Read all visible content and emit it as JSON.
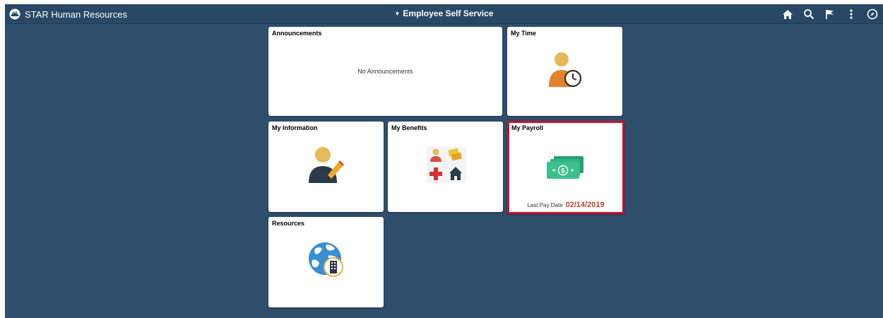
{
  "header": {
    "app_title": "STAR Human Resources",
    "center_title": "Employee Self Service",
    "icons": [
      "home-icon",
      "search-icon",
      "flag-icon",
      "more-vertical-icon",
      "navbar-compass-icon"
    ]
  },
  "tiles": {
    "announcements": {
      "title": "Announcements",
      "body": "No Announcements"
    },
    "my_time": {
      "title": "My Time",
      "icon": "person-clock-icon"
    },
    "my_information": {
      "title": "My Information",
      "icon": "person-pencil-icon"
    },
    "my_benefits": {
      "title": "My Benefits",
      "icon": "benefits-grid-icon"
    },
    "my_payroll": {
      "title": "My Payroll",
      "icon": "money-bills-icon",
      "last_pay_label": "Last Pay Date",
      "last_pay_date": "02/14/2019"
    },
    "resources": {
      "title": "Resources",
      "icon": "globe-building-icon"
    }
  },
  "colors": {
    "background": "#2f4e6b",
    "header": "#284866",
    "selected_border": "#c8102e",
    "pay_date": "#b5472a"
  }
}
